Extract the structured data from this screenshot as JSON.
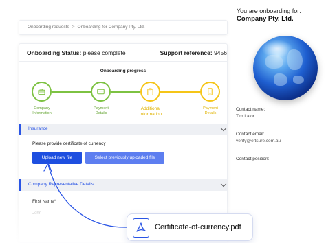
{
  "right_panel": {
    "title": "You are onboarding for:",
    "company": "Company Pty. Ltd.",
    "contact_name_label": "Contact name:",
    "contact_name_value": "Tim Lalor",
    "contact_email_label": "Contact email:",
    "contact_email_value": "verify@eftsure.com.au",
    "contact_position_label": "Contact position:"
  },
  "breadcrumb": {
    "items": [
      "Onboarding requests",
      "Onboarding for Company Pty. Ltd."
    ],
    "separator": ">"
  },
  "status": {
    "label": "Onboarding Status:",
    "value": "please complete",
    "support_label": "Support reference:",
    "support_value": "9456"
  },
  "progress": {
    "title": "Onboarding progress",
    "steps": [
      {
        "label_line1": "Company",
        "label_line2": "Information",
        "state": "complete",
        "icon": "briefcase-icon"
      },
      {
        "label_line1": "Payment",
        "label_line2": "Details",
        "state": "complete",
        "icon": "credit-card-icon"
      },
      {
        "label_line1": "Additional",
        "label_line2": "Information",
        "state": "current",
        "icon": "clipboard-icon"
      },
      {
        "label_line1": "Payment",
        "label_line2": "Details",
        "state": "pending",
        "icon": "phone-icon"
      }
    ]
  },
  "insurance": {
    "header": "Insurance",
    "prompt": "Please provide certificate of currency",
    "upload_button": "Upload new file",
    "select_button": "Select previously uploaded file"
  },
  "representative": {
    "header": "Company Representative Details",
    "first_name_label": "First Name*",
    "first_name_placeholder": "John"
  },
  "file": {
    "name": "Certificate-of-currency.pdf",
    "icon": "pdf-file-icon"
  },
  "colors": {
    "accent": "#1e4fe0",
    "complete": "#7dc242",
    "current": "#f5c518"
  }
}
